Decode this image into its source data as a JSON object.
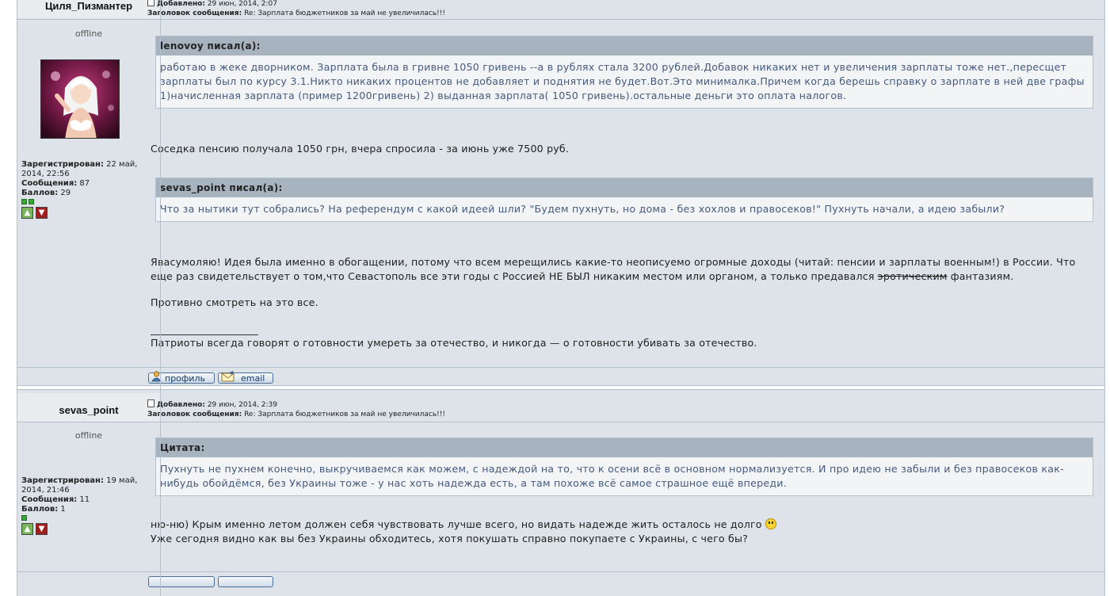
{
  "posts": [
    {
      "author": "Циля_Пизмантер",
      "added_label": "Добавлено:",
      "added_value": "29 июн, 2014, 2:07",
      "subject_label": "Заголовок сообщения:",
      "subject_value": "Re: Зарплата бюджетников за май не увеличилась!!!",
      "status": "offline",
      "registered_label": "Зарегистрирован:",
      "registered_value": "22 май, 2014, 22:56",
      "messages_label": "Сообщения:",
      "messages_value": "87",
      "points_label": "Баллов:",
      "points_value": "29",
      "quotes": [
        {
          "title": "lenovoy писал(а):",
          "text": "работаю в жеке дворником. Зарплата была в гривне 1050 гривень --а в рублях стала 3200 рублей.Добавок никаких нет и увеличения зарплаты тоже нет.,пересщет зарплаты был по курсу 3.1.Никто никаких процентов не добавляет и поднятия не будет.Вот.Это минималка.Причем когда берешь справку о зарплате в ней две графы 1)начисленная зарплата (пример 1200гривень) 2) выданная зарплата( 1050 гривень).остальные деньги это оплата налогов."
        },
        {
          "title": "sevas_point писал(а):",
          "text": "Что за нытики тут собрались? На референдум с какой идеей шли? \"Будем пухнуть, но дома - без хохлов и правосеков!\" Пухнуть начали, а идею забыли?"
        }
      ],
      "reply_1": "Соседка пенсию получала 1050 грн, вчера спросила - за июнь уже 7500 руб.",
      "reply_2a": "Явасумоляю! Идея была именно в обогащении, потому что всем мерещились какие-то неописуемо огромные доходы (читай: пенсии и зарплаты военным!) в России. Что еще раз свидетельствует о том,что Севастополь все эти годы с Россией НЕ БЫЛ никаким местом или органом, а только предавался ",
      "reply_2_strike": "эротическим",
      "reply_2b": " фантазиям.",
      "reply_3": "Противно смотреть на это все.",
      "signature": "Патриоты всегда говорят о готовности умереть за отечество, и никогда — о готовности убивать за отечество.",
      "profile_btn": "профиль",
      "email_btn": "email"
    },
    {
      "author": "sevas_point",
      "added_label": "Добавлено:",
      "added_value": "29 июн, 2014, 2:39",
      "subject_label": "Заголовок сообщения:",
      "subject_value": "Re: Зарплата бюджетников за май не увеличилась!!!",
      "status": "offline",
      "registered_label": "Зарегистрирован:",
      "registered_value": "19 май, 2014, 21:46",
      "messages_label": "Сообщения:",
      "messages_value": "11",
      "points_label": "Баллов:",
      "points_value": "1",
      "quotes": [
        {
          "title": "Цитата:",
          "text": "Пухнуть не пухнем конечно, выкручиваемся как можем, с надеждой на то, что к осени всё в основном нормализуется. И про идею не забыли и без правосеков как-нибудь обойдёмся, без Украины тоже - у нас хоть надежда есть, а там похоже всё самое страшное ещё впереди."
        }
      ],
      "reply_1": "ню-ню) Крым именно летом должен себя чувствовать лучше всего, но видать надежде жить осталось не долго",
      "reply_2": "Уже сегодня видно как вы без Украины обходитесь, хотя покушать справно покупаете с Украины, с чего бы?"
    }
  ],
  "icons": {
    "post": "post-icon",
    "thumb_up": "thumb-up-icon",
    "thumb_down": "thumb-down-icon",
    "profile": "profile-icon",
    "email": "envelope-icon",
    "smiley": "smiley-icon"
  },
  "colors": {
    "background": "#dde3e8",
    "quote_header": "#a7b3bf",
    "quote_text": "#465a7e",
    "rating_dot": "#3aa63a"
  }
}
